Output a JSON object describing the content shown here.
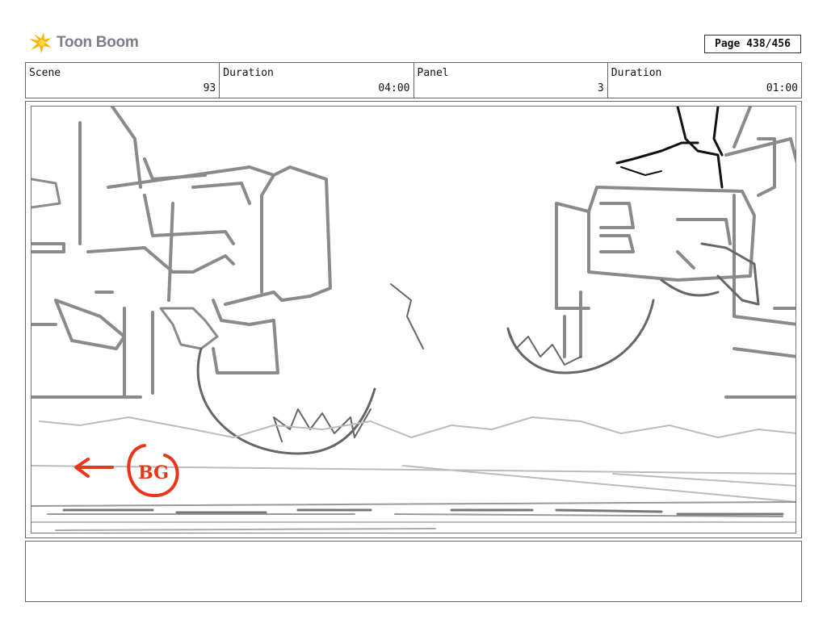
{
  "header": {
    "logo_text": "Toon Boom",
    "page": "Page 438/456"
  },
  "info": {
    "scene_label": "Scene",
    "scene_value": "93",
    "duration_label": "Duration",
    "duration_value": "04:00",
    "panel_label": "Panel",
    "panel_value": "3",
    "panel_duration_label": "Duration",
    "panel_duration_value": "01:00"
  },
  "drawing": {
    "annotation_text": "BG",
    "annotation_color": "#e8361a",
    "sketch_color": "#8a8a8a"
  },
  "notes": {
    "text": ""
  }
}
